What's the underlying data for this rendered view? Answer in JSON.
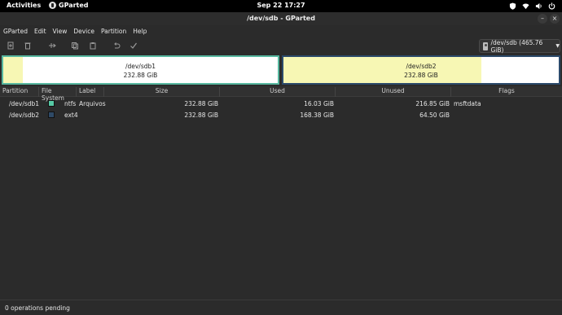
{
  "topbar": {
    "activities": "Activities",
    "app_name": "GParted",
    "clock": "Sep 22  17:27"
  },
  "window": {
    "title": "/dev/sdb - GParted"
  },
  "menu": [
    "GParted",
    "Edit",
    "View",
    "Device",
    "Partition",
    "Help"
  ],
  "toolbar": {
    "device_selector": "/dev/sdb (465.76 GiB)"
  },
  "diskmap": {
    "partitions": [
      {
        "name": "/dev/sdb1",
        "size": "232.88 GiB",
        "color": "#57b8a0",
        "used_fraction": 0.07
      },
      {
        "name": "/dev/sdb2",
        "size": "232.88 GiB",
        "color": "#2b4a6b",
        "used_fraction": 0.72
      }
    ]
  },
  "table": {
    "headers": {
      "partition": "Partition",
      "filesystem": "File System",
      "label": "Label",
      "size": "Size",
      "used": "Used",
      "unused": "Unused",
      "flags": "Flags"
    },
    "rows": [
      {
        "partition": "/dev/sdb1",
        "fs_color": "#57c9a5",
        "filesystem": "ntfs",
        "label": "Arquivos",
        "size": "232.88 GiB",
        "used": "16.03 GiB",
        "unused": "216.85 GiB",
        "flags": "msftdata"
      },
      {
        "partition": "/dev/sdb2",
        "fs_color": "#2f4a66",
        "filesystem": "ext4",
        "label": "",
        "size": "232.88 GiB",
        "used": "168.38 GiB",
        "unused": "64.50 GiB",
        "flags": ""
      }
    ]
  },
  "status": {
    "text": "0 operations pending"
  }
}
